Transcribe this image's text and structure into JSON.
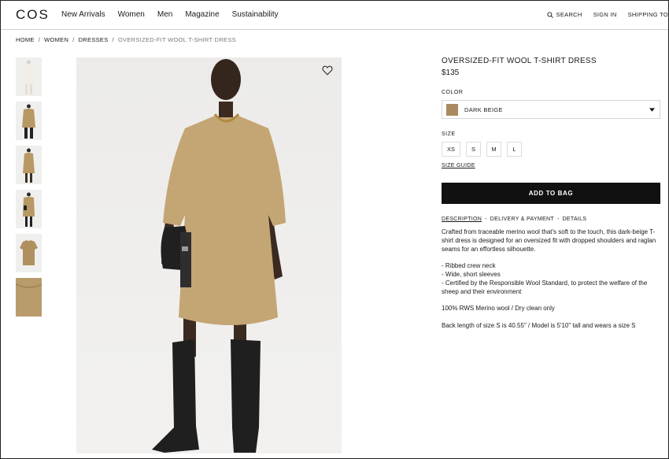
{
  "brand": {
    "logo": "COS"
  },
  "nav": {
    "items": [
      "New Arrivals",
      "Women",
      "Men",
      "Magazine",
      "Sustainability"
    ]
  },
  "utility": {
    "search": "SEARCH",
    "sign_in": "SIGN IN",
    "shipping": "SHIPPING TO"
  },
  "breadcrumb": {
    "items": [
      "HOME",
      "WOMEN",
      "DRESSES"
    ],
    "current": "OVERSIZED-FIT WOOL T-SHIRT DRESS",
    "separator": "/"
  },
  "icons": {
    "search": "search-icon",
    "wishlist": "heart-icon",
    "dropdown": "caret-down-icon"
  },
  "colors": {
    "accent": "#111111",
    "swatch": "#a98a5f",
    "dress": "#c4a574"
  },
  "product": {
    "title": "OVERSIZED-FIT WOOL T-SHIRT DRESS",
    "price": "$135",
    "color_label": "COLOR",
    "color_value": "DARK BEIGE",
    "size_label": "SIZE",
    "sizes": [
      "XS",
      "S",
      "M",
      "L"
    ],
    "size_guide": "SIZE GUIDE",
    "add_to_bag": "ADD TO BAG"
  },
  "tabs": {
    "items": [
      "DESCRIPTION",
      "DELIVERY & PAYMENT",
      "DETAILS"
    ],
    "separator": "-"
  },
  "description": {
    "intro": "Crafted from traceable merino wool that's soft to the touch, this dark-beige T-shirt dress is designed for an oversized fit with dropped shoulders and raglan seams for an effortless silhouette.",
    "bullets": [
      "- Ribbed crew neck",
      "- Wide, short sleeves",
      "- Certified by the Responsible Wool Standard, to protect the welfare of the sheep and their environment"
    ],
    "composition": "100% RWS Merino wool / Dry clean only",
    "fit": "Back length of size S is 40.55\" / Model is 5'10\" tall and wears a size S"
  }
}
